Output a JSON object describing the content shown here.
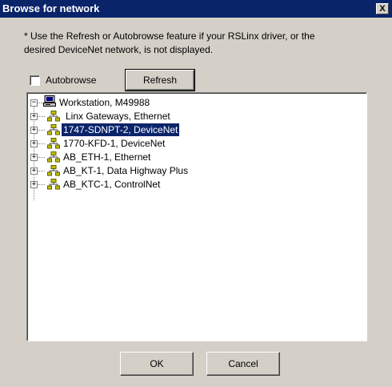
{
  "dialog": {
    "title": "Browse for network",
    "close_glyph": "X"
  },
  "info": {
    "line1": "* Use the Refresh or Autobrowse feature if your RSLinx driver, or the",
    "line2": "desired DeviceNet network, is not displayed."
  },
  "controls": {
    "autobrowse_label": "Autobrowse",
    "autobrowse_checked": false,
    "refresh_label": "Refresh"
  },
  "tree": {
    "root": {
      "label": "Workstation, M49988",
      "icon": "computer-icon",
      "expander": "minus"
    },
    "children": [
      {
        "label": "Linx Gateways, Ethernet",
        "icon": "network-icon",
        "expander": "plus",
        "selected": false
      },
      {
        "label": "1747-SDNPT-2, DeviceNet",
        "icon": "network-icon",
        "expander": "plus",
        "selected": true
      },
      {
        "label": "1770-KFD-1, DeviceNet",
        "icon": "network-icon",
        "expander": "plus",
        "selected": false
      },
      {
        "label": "AB_ETH-1, Ethernet",
        "icon": "network-icon",
        "expander": "plus",
        "selected": false
      },
      {
        "label": "AB_KT-1, Data Highway Plus",
        "icon": "network-icon",
        "expander": "plus",
        "selected": false
      },
      {
        "label": "AB_KTC-1, ControlNet",
        "icon": "network-icon",
        "expander": "plus",
        "selected": false
      }
    ]
  },
  "buttons": {
    "ok_label": "OK",
    "cancel_label": "Cancel"
  },
  "colors": {
    "titlebar": "#0a246a",
    "face": "#d4d0c8",
    "selection": "#0a246a"
  }
}
